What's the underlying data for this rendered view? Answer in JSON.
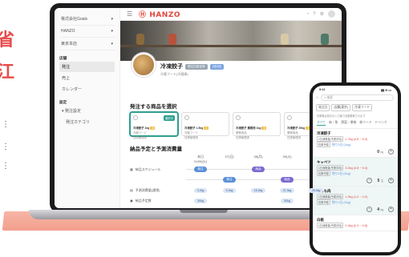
{
  "background": {
    "text_line1": "省",
    "text_line2": "江",
    "dots": "⋮"
  },
  "app": {
    "logo": "HANZO"
  },
  "sidebar": {
    "selects": [
      "株式会社Goals",
      "HANZO",
      "東京本店"
    ],
    "sections": [
      {
        "title": "店舗",
        "items": [
          "発注",
          "売上",
          "カレンダー"
        ],
        "active": 0
      },
      {
        "title": "設定",
        "items": [
          "発注設定",
          "発注カテゴリ"
        ],
        "active": -1
      }
    ]
  },
  "profile": {
    "name": "冷凍餃子",
    "tag1": "発注日設定済",
    "tag2": "1回4回",
    "sub": "冷蔵フード(冷蔵庫)"
  },
  "section_products": "発注する商品を選択",
  "cards": [
    {
      "name": "冷凍餃子 1kg",
      "badge": "1",
      "sub1": "冷蔵フード",
      "sub2": "在庫管理済",
      "selected": true,
      "sel_label": "選択中"
    },
    {
      "name": "冷凍餃子 1.5kg",
      "badge": "1",
      "sub1": "冷蔵フード",
      "sub2": "在庫管理済",
      "selected": false
    },
    {
      "name": "冷凍餃子 業務用 1kg",
      "badge": "1",
      "sub1": "業務用品",
      "sub2": "在庫管理済",
      "selected": false
    },
    {
      "name": "冷凍餃子 20kg",
      "badge": "1",
      "sub1": "業務用品",
      "sub2": "在庫管理済",
      "selected": false
    }
  ],
  "section_schedule": "納品予定と予測消費量",
  "schedule": {
    "headers": [
      "本日\n11/26(火)",
      "27(日)",
      "28(月)",
      "29(火)",
      "30(日)"
    ],
    "row_delivery": {
      "label": "納品スケジュール",
      "cells": [
        "発注",
        "",
        "納品",
        "",
        ""
      ]
    },
    "row_mid": {
      "cells": [
        "",
        "発注",
        "",
        "納品",
        ""
      ]
    },
    "row_forecast": {
      "label": "予測消費量(通常)",
      "cells": [
        "3.2kg",
        "5.4kg",
        "18.2kg",
        "21.3kg",
        "26.4kg"
      ]
    },
    "row_stock": {
      "label": "納品予定数",
      "cells": [
        "30kg",
        "",
        "",
        "30kg",
        ""
      ]
    }
  },
  "phone": {
    "time": "9:41",
    "status_right": "▮▮ ≋ ▭",
    "search_placeholder": "検索",
    "filters": [
      "発注日",
      "店舗(東京)",
      "冷凍フード"
    ],
    "note": "在庫数は前日の入力値で自動更新されます",
    "tabs": [
      "すべて",
      "肉・魚",
      "野菜・果物",
      "粉フード",
      "ドリンク"
    ],
    "items": [
      {
        "name": "冷凍餃子",
        "line1a": "1日消費量(予測平均)",
        "line1b": "1.7kg (4.8 ~ 6.4)",
        "line2a": "在庫予想",
        "line2b": "残り3日 (1kg)",
        "qty": "0",
        "unit": "kg"
      },
      {
        "name": "キャベツ",
        "line1a": "1日消費量(予測平均)",
        "line1b": "3.2kg (4.8 ~ 6.4)",
        "line2a": "在庫予想",
        "line2b": "残り2日 (1kg)",
        "qty": "5",
        "unit": "玉"
      },
      {
        "name": "鶏もも肉",
        "line1a": "1日消費量(予測平均)",
        "line1b": "1.0kg (1.0 ~ 2.0)",
        "line2a": "在庫予想",
        "line2b": "残り1日 (1kg)",
        "qty": "4",
        "unit": "kg"
      },
      {
        "name": "白桃",
        "line1a": "1日消費量(予測平均)",
        "line1b": "0.4kg (0.3 ~ 0.8)",
        "line2a": "在庫予想",
        "line2b": "",
        "qty": "",
        "unit": ""
      }
    ]
  }
}
